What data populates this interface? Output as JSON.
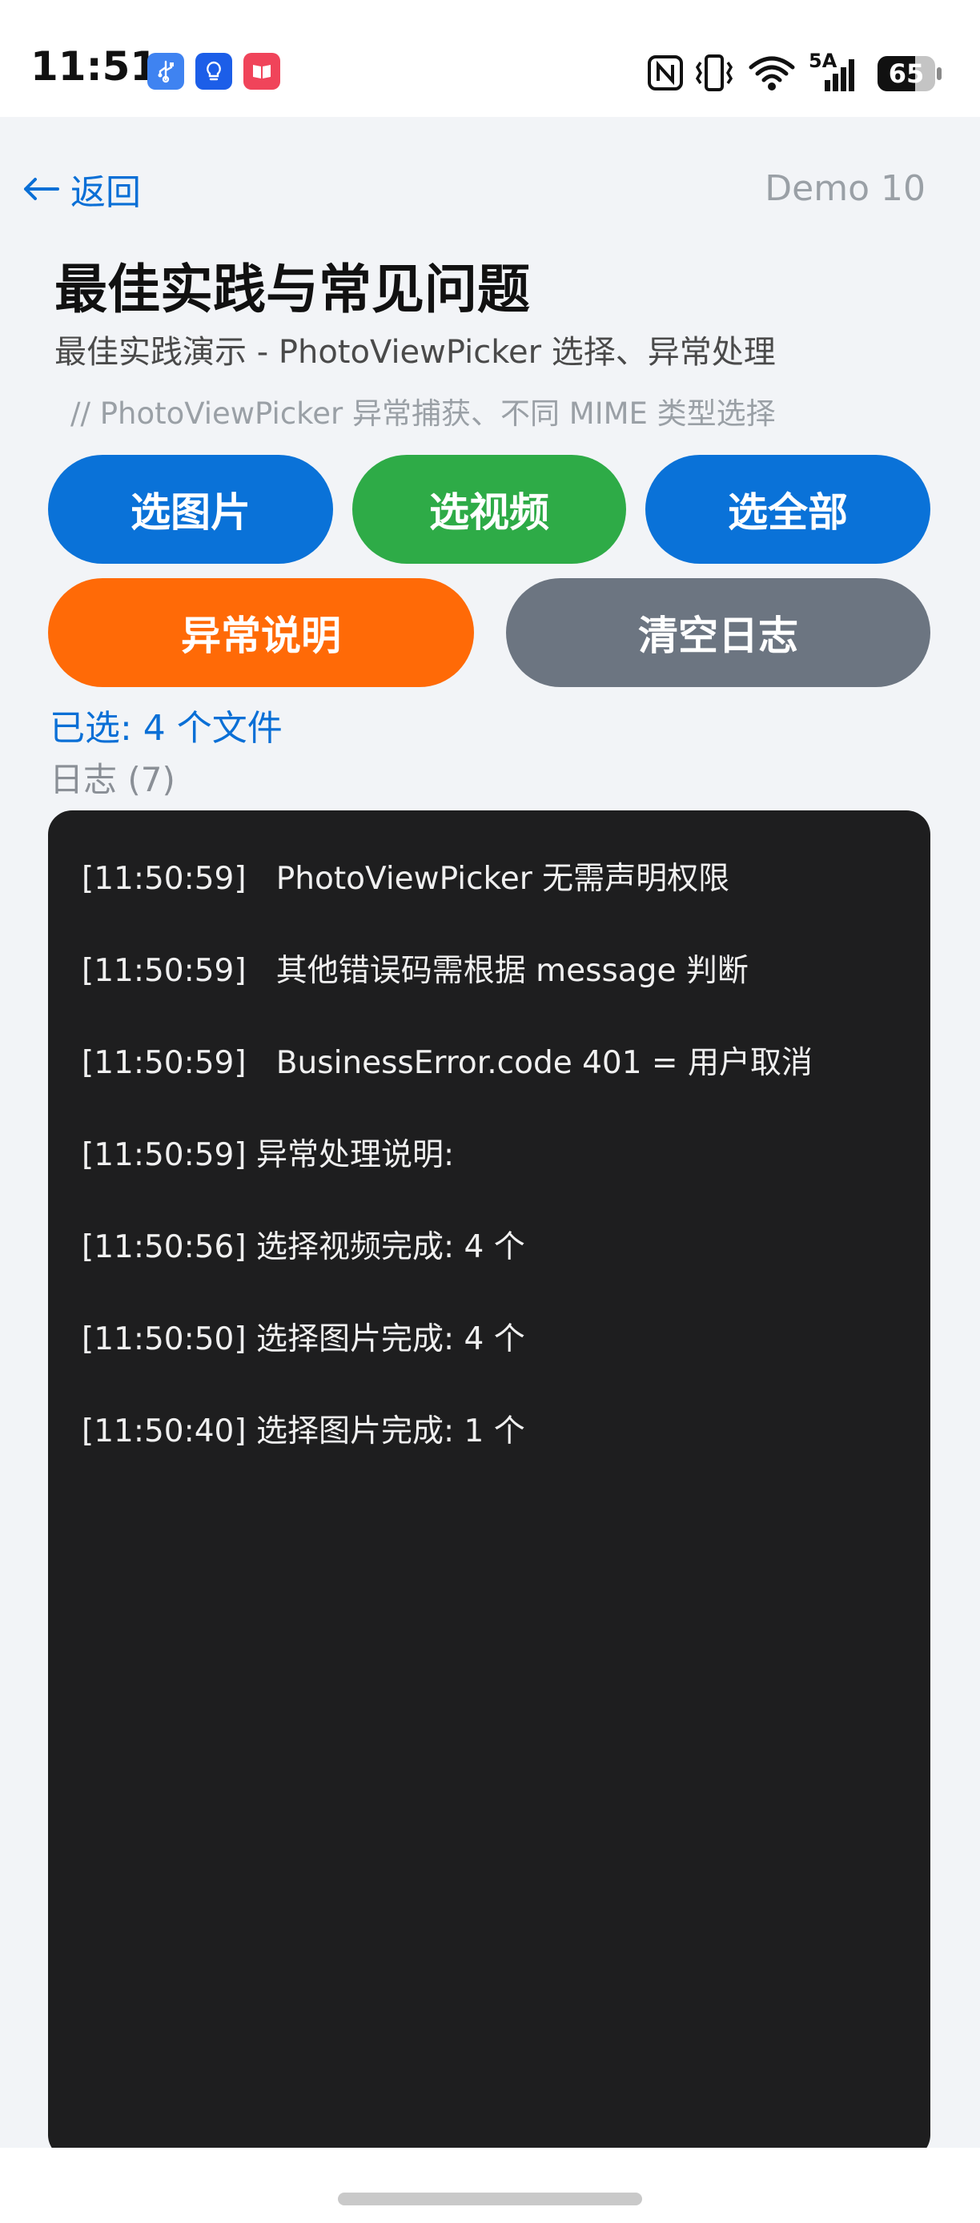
{
  "status_bar": {
    "time": "11:51",
    "battery": "65",
    "signal_label": "5A",
    "app_icons": [
      "usb-icon",
      "lightbulb-icon",
      "book-icon"
    ],
    "right_icons": [
      "nfc-icon",
      "vibrate-icon",
      "wifi-icon",
      "cellular-signal-icon",
      "battery-icon"
    ]
  },
  "header": {
    "back_label": "返回",
    "demo_label": "Demo 10"
  },
  "page": {
    "title": "最佳实践与常见问题",
    "subtitle": "最佳实践演示 - PhotoViewPicker 选择、异常处理",
    "comment": "// PhotoViewPicker 异常捕获、不同 MIME 类型选择"
  },
  "buttons": {
    "pick_image": "选图片",
    "pick_video": "选视频",
    "pick_all": "选全部",
    "exception_info": "异常说明",
    "clear_log": "清空日志"
  },
  "selection": {
    "selected_text": "已选: 4 个文件",
    "log_count_text": "日志 (7)"
  },
  "log": {
    "entries": [
      "[11:50:59]   PhotoViewPicker 无需声明权限",
      "[11:50:59]   其他错误码需根据 message 判断",
      "[11:50:59]   BusinessError.code 401 = 用户取消",
      "[11:50:59] 异常处理说明:",
      "[11:50:56] 选择视频完成: 4 个",
      "[11:50:50] 选择图片完成: 4 个",
      "[11:50:40] 选择图片完成: 1 个"
    ]
  },
  "colors": {
    "primary_blue": "#0a72d8",
    "green": "#2eab47",
    "orange": "#ff6a07",
    "gray": "#6c7581",
    "log_bg": "#1e1e1f"
  }
}
